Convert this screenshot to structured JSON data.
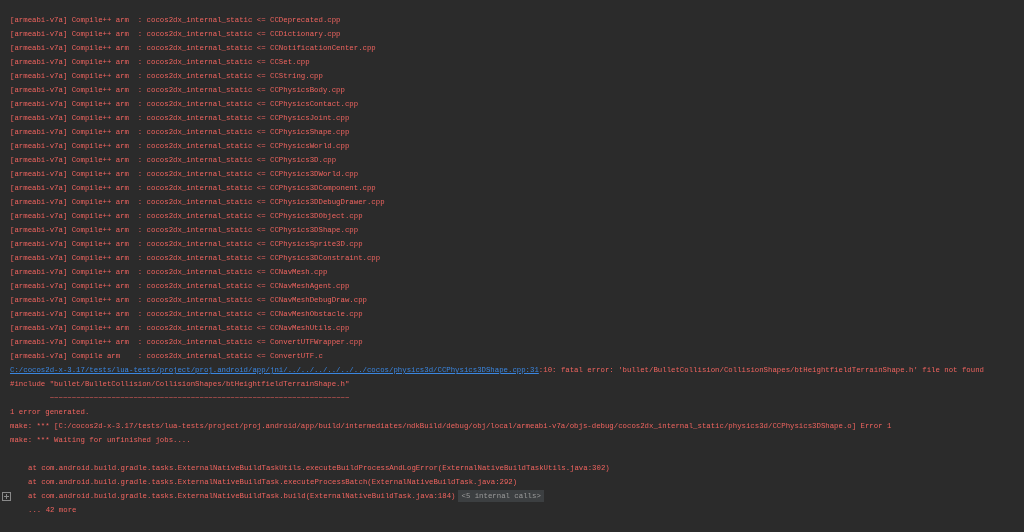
{
  "console": {
    "lines": [
      {
        "kind": "compile",
        "text": "[armeabi-v7a] Compile++ arm  : cocos2dx_internal_static <= CCDeprecated.cpp"
      },
      {
        "kind": "compile",
        "text": "[armeabi-v7a] Compile++ arm  : cocos2dx_internal_static <= CCDictionary.cpp"
      },
      {
        "kind": "compile",
        "text": "[armeabi-v7a] Compile++ arm  : cocos2dx_internal_static <= CCNotificationCenter.cpp"
      },
      {
        "kind": "compile",
        "text": "[armeabi-v7a] Compile++ arm  : cocos2dx_internal_static <= CCSet.cpp"
      },
      {
        "kind": "compile",
        "text": "[armeabi-v7a] Compile++ arm  : cocos2dx_internal_static <= CCString.cpp"
      },
      {
        "kind": "compile",
        "text": "[armeabi-v7a] Compile++ arm  : cocos2dx_internal_static <= CCPhysicsBody.cpp"
      },
      {
        "kind": "compile",
        "text": "[armeabi-v7a] Compile++ arm  : cocos2dx_internal_static <= CCPhysicsContact.cpp"
      },
      {
        "kind": "compile",
        "text": "[armeabi-v7a] Compile++ arm  : cocos2dx_internal_static <= CCPhysicsJoint.cpp"
      },
      {
        "kind": "compile",
        "text": "[armeabi-v7a] Compile++ arm  : cocos2dx_internal_static <= CCPhysicsShape.cpp"
      },
      {
        "kind": "compile",
        "text": "[armeabi-v7a] Compile++ arm  : cocos2dx_internal_static <= CCPhysicsWorld.cpp"
      },
      {
        "kind": "compile",
        "text": "[armeabi-v7a] Compile++ arm  : cocos2dx_internal_static <= CCPhysics3D.cpp"
      },
      {
        "kind": "compile",
        "text": "[armeabi-v7a] Compile++ arm  : cocos2dx_internal_static <= CCPhysics3DWorld.cpp"
      },
      {
        "kind": "compile",
        "text": "[armeabi-v7a] Compile++ arm  : cocos2dx_internal_static <= CCPhysics3DComponent.cpp"
      },
      {
        "kind": "compile",
        "text": "[armeabi-v7a] Compile++ arm  : cocos2dx_internal_static <= CCPhysics3DDebugDrawer.cpp"
      },
      {
        "kind": "compile",
        "text": "[armeabi-v7a] Compile++ arm  : cocos2dx_internal_static <= CCPhysics3DObject.cpp"
      },
      {
        "kind": "compile",
        "text": "[armeabi-v7a] Compile++ arm  : cocos2dx_internal_static <= CCPhysics3DShape.cpp"
      },
      {
        "kind": "compile",
        "text": "[armeabi-v7a] Compile++ arm  : cocos2dx_internal_static <= CCPhysicsSprite3D.cpp"
      },
      {
        "kind": "compile",
        "text": "[armeabi-v7a] Compile++ arm  : cocos2dx_internal_static <= CCPhysics3DConstraint.cpp"
      },
      {
        "kind": "compile",
        "text": "[armeabi-v7a] Compile++ arm  : cocos2dx_internal_static <= CCNavMesh.cpp"
      },
      {
        "kind": "compile",
        "text": "[armeabi-v7a] Compile++ arm  : cocos2dx_internal_static <= CCNavMeshAgent.cpp"
      },
      {
        "kind": "compile",
        "text": "[armeabi-v7a] Compile++ arm  : cocos2dx_internal_static <= CCNavMeshDebugDraw.cpp"
      },
      {
        "kind": "compile",
        "text": "[armeabi-v7a] Compile++ arm  : cocos2dx_internal_static <= CCNavMeshObstacle.cpp"
      },
      {
        "kind": "compile",
        "text": "[armeabi-v7a] Compile++ arm  : cocos2dx_internal_static <= CCNavMeshUtils.cpp"
      },
      {
        "kind": "compile",
        "text": "[armeabi-v7a] Compile++ arm  : cocos2dx_internal_static <= ConvertUTFWrapper.cpp"
      },
      {
        "kind": "compile",
        "text": "[armeabi-v7a] Compile arm    : cocos2dx_internal_static <= ConvertUTF.c"
      },
      {
        "kind": "location",
        "link": "C:/cocos2d-x-3.17/tests/lua-tests/project/proj.android/app/jni/../../../../../../cocos/physics3d/CCPhysics3DShape.cpp:31",
        "text": ":10: fatal error: 'bullet/BulletCollision/CollisionShapes/btHeightfieldTerrainShape.h' file not found"
      },
      {
        "kind": "plain",
        "text": "#include \"bullet/BulletCollision/CollisionShapes/btHeightfieldTerrainShape.h\""
      },
      {
        "kind": "squiggle",
        "text": "~~~~~~~~~~~~~~~~~~~~~~~~~~~~~~~~~~~~~~~~~~~~~~~~~~~~~~~~~~~~~~~~~~~~"
      },
      {
        "kind": "plain",
        "text": "1 error generated."
      },
      {
        "kind": "plain",
        "text": "make: *** [C:/cocos2d-x-3.17/tests/lua-tests/project/proj.android/app/build/intermediates/ndkBuild/debug/obj/local/armeabi-v7a/objs-debug/cocos2dx_internal_static/physics3d/CCPhysics3DShape.o] Error 1"
      },
      {
        "kind": "plain",
        "text": "make: *** Waiting for unfinished jobs...."
      },
      {
        "kind": "blank"
      },
      {
        "kind": "stack",
        "expandable": false,
        "text": "at com.android.build.gradle.tasks.ExternalNativeBuildTaskUtils.executeBuildProcessAndLogError(ExternalNativeBuildTaskUtils.java:302)"
      },
      {
        "kind": "stack",
        "expandable": false,
        "text": "at com.android.build.gradle.tasks.ExternalNativeBuildTask.executeProcessBatch(ExternalNativeBuildTask.java:292)"
      },
      {
        "kind": "stack",
        "expandable": true,
        "text": "at com.android.build.gradle.tasks.ExternalNativeBuildTask.build(ExternalNativeBuildTask.java:184)",
        "badge": "<5 internal calls>"
      },
      {
        "kind": "stack",
        "expandable": false,
        "text": "... 42 more"
      }
    ]
  }
}
